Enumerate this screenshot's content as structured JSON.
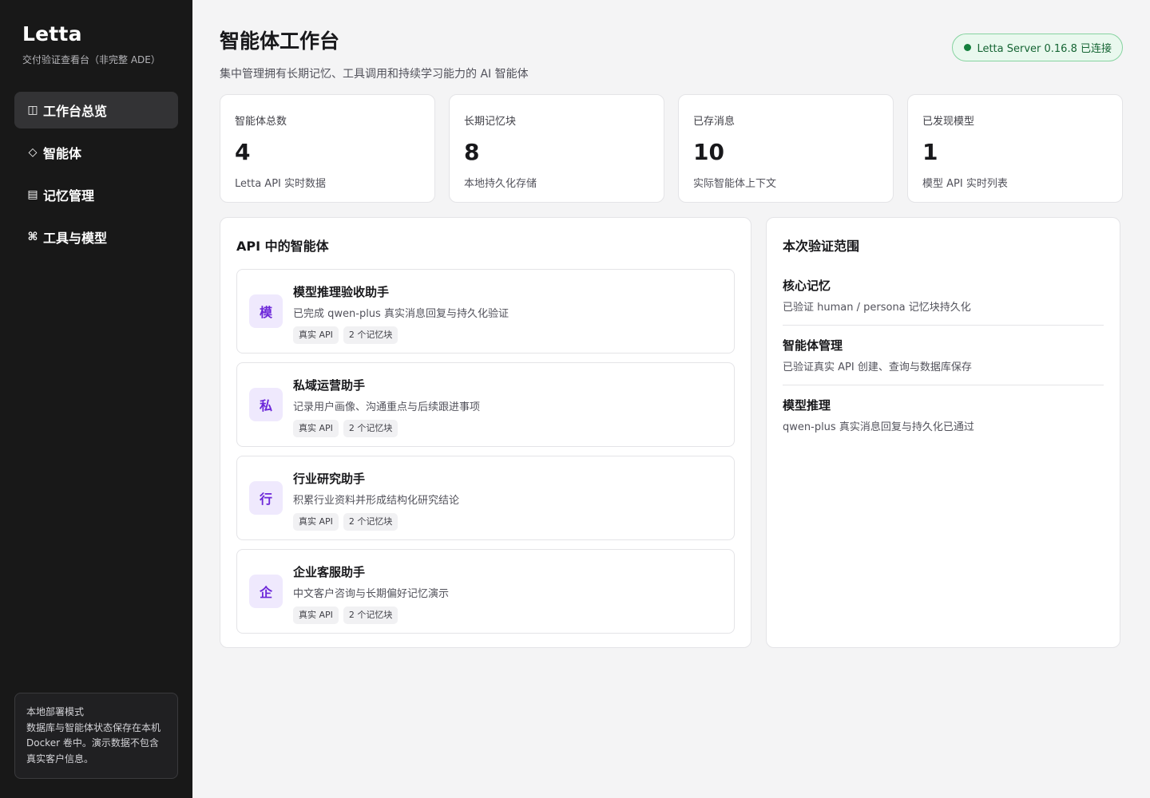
{
  "sidebar": {
    "brand": "Letta",
    "brand_sub": "交付验证查看台（非完整 ADE）",
    "items": [
      {
        "icon": "◫",
        "label": "工作台总览"
      },
      {
        "icon": "◇",
        "label": "智能体"
      },
      {
        "icon": "▤",
        "label": "记忆管理"
      },
      {
        "icon": "⌘",
        "label": "工具与模型"
      }
    ],
    "deploy_title": "本地部署模式",
    "deploy_text": "数据库与智能体状态保存在本机 Docker 卷中。演示数据不包含真实客户信息。"
  },
  "header": {
    "title": "智能体工作台",
    "subtitle": "集中管理拥有长期记忆、工具调用和持续学习能力的 AI 智能体",
    "status": "Letta Server 0.16.8 已连接"
  },
  "stats": [
    {
      "label": "智能体总数",
      "value": "4",
      "note": "Letta API 实时数据"
    },
    {
      "label": "长期记忆块",
      "value": "8",
      "note": "本地持久化存储"
    },
    {
      "label": "已存消息",
      "value": "10",
      "note": "实际智能体上下文"
    },
    {
      "label": "已发现模型",
      "value": "1",
      "note": "模型 API 实时列表"
    }
  ],
  "agents_panel": {
    "title": "API 中的智能体",
    "agents": [
      {
        "avatar": "模",
        "name": "模型推理验收助手",
        "desc": "已完成 qwen-plus 真实消息回复与持久化验证",
        "tags": [
          "真实 API",
          "2 个记忆块"
        ]
      },
      {
        "avatar": "私",
        "name": "私域运营助手",
        "desc": "记录用户画像、沟通重点与后续跟进事项",
        "tags": [
          "真实 API",
          "2 个记忆块"
        ]
      },
      {
        "avatar": "行",
        "name": "行业研究助手",
        "desc": "积累行业资料并形成结构化研究结论",
        "tags": [
          "真实 API",
          "2 个记忆块"
        ]
      },
      {
        "avatar": "企",
        "name": "企业客服助手",
        "desc": "中文客户咨询与长期偏好记忆演示",
        "tags": [
          "真实 API",
          "2 个记忆块"
        ]
      }
    ]
  },
  "scope_panel": {
    "title": "本次验证范围",
    "items": [
      {
        "name": "核心记忆",
        "desc": "已验证 human / persona 记忆块持久化"
      },
      {
        "name": "智能体管理",
        "desc": "已验证真实 API 创建、查询与数据库保存"
      },
      {
        "name": "模型推理",
        "desc": "qwen-plus 真实消息回复与持久化已通过"
      }
    ]
  },
  "colors": {
    "sidebar_bg": "#181818",
    "accent_purple": "#6d28d9",
    "status_green": "#15803d"
  }
}
